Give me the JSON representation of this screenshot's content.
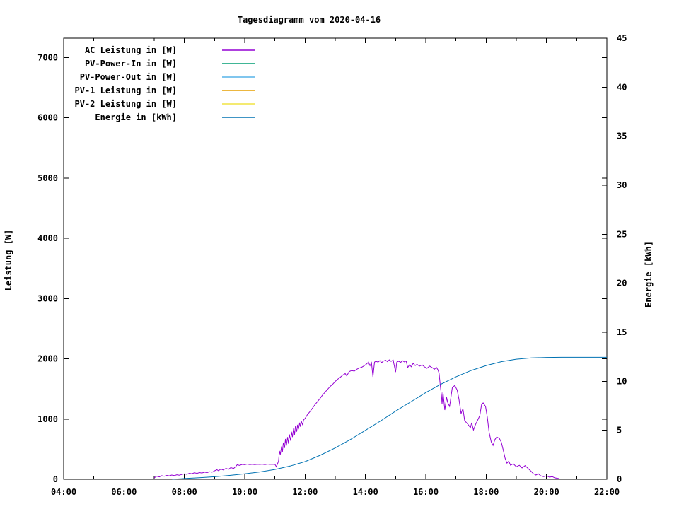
{
  "title": "Tagesdiagramm vom 2020-04-16",
  "chart_data": {
    "type": "line",
    "title": "Tagesdiagramm vom 2020-04-16",
    "grid": false,
    "legend_position": "top-left-inside",
    "x_axis": {
      "min": 4,
      "max": 22,
      "major": [
        {
          "t": 4,
          "label": "04:00"
        },
        {
          "t": 6,
          "label": "06:00"
        },
        {
          "t": 8,
          "label": "08:00"
        },
        {
          "t": 10,
          "label": "10:00"
        },
        {
          "t": 12,
          "label": "12:00"
        },
        {
          "t": 14,
          "label": "14:00"
        },
        {
          "t": 16,
          "label": "16:00"
        },
        {
          "t": 18,
          "label": "18:00"
        },
        {
          "t": 20,
          "label": "20:00"
        },
        {
          "t": 22,
          "label": "22:00"
        }
      ],
      "minor": [
        5,
        7,
        9,
        11,
        13,
        15,
        17,
        19,
        21
      ]
    },
    "y_left": {
      "label": "Leistung [W]",
      "ticks": [
        0,
        1000,
        2000,
        3000,
        4000,
        5000,
        6000,
        7000
      ],
      "max": 7320
    },
    "y_right": {
      "label": "Energie [kWh]",
      "ticks": [
        0,
        5,
        10,
        15,
        20,
        25,
        30,
        35,
        40,
        45
      ],
      "max": 45
    },
    "series": [
      {
        "name": "AC Leistung in [W]",
        "color": "#9400d3",
        "axis": "left",
        "points": [
          [
            7.0,
            25
          ],
          [
            7.08,
            50
          ],
          [
            7.17,
            40
          ],
          [
            7.25,
            60
          ],
          [
            7.33,
            50
          ],
          [
            7.42,
            65
          ],
          [
            7.5,
            58
          ],
          [
            7.58,
            70
          ],
          [
            7.67,
            62
          ],
          [
            7.75,
            75
          ],
          [
            7.83,
            68
          ],
          [
            7.92,
            80
          ],
          [
            8.0,
            90
          ],
          [
            8.08,
            82
          ],
          [
            8.17,
            100
          ],
          [
            8.25,
            92
          ],
          [
            8.33,
            108
          ],
          [
            8.42,
            98
          ],
          [
            8.5,
            112
          ],
          [
            8.58,
            104
          ],
          [
            8.67,
            118
          ],
          [
            8.75,
            110
          ],
          [
            8.83,
            125
          ],
          [
            8.92,
            118
          ],
          [
            9.0,
            140
          ],
          [
            9.08,
            158
          ],
          [
            9.13,
            142
          ],
          [
            9.21,
            170
          ],
          [
            9.29,
            155
          ],
          [
            9.38,
            182
          ],
          [
            9.46,
            165
          ],
          [
            9.54,
            195
          ],
          [
            9.63,
            178
          ],
          [
            9.71,
            215
          ],
          [
            9.75,
            240
          ],
          [
            9.83,
            230
          ],
          [
            9.92,
            248
          ],
          [
            10.0,
            242
          ],
          [
            10.08,
            252
          ],
          [
            10.17,
            244
          ],
          [
            10.25,
            250
          ],
          [
            10.33,
            243
          ],
          [
            10.42,
            250
          ],
          [
            10.5,
            246
          ],
          [
            10.58,
            251
          ],
          [
            10.67,
            244
          ],
          [
            10.75,
            252
          ],
          [
            10.83,
            247
          ],
          [
            10.92,
            250
          ],
          [
            11.0,
            248
          ],
          [
            11.05,
            208
          ],
          [
            11.08,
            250
          ],
          [
            11.12,
            300
          ],
          [
            11.15,
            470
          ],
          [
            11.18,
            410
          ],
          [
            11.22,
            545
          ],
          [
            11.25,
            455
          ],
          [
            11.28,
            610
          ],
          [
            11.32,
            520
          ],
          [
            11.35,
            670
          ],
          [
            11.38,
            560
          ],
          [
            11.42,
            700
          ],
          [
            11.45,
            590
          ],
          [
            11.48,
            745
          ],
          [
            11.52,
            640
          ],
          [
            11.55,
            790
          ],
          [
            11.58,
            700
          ],
          [
            11.62,
            845
          ],
          [
            11.65,
            740
          ],
          [
            11.68,
            880
          ],
          [
            11.72,
            790
          ],
          [
            11.75,
            905
          ],
          [
            11.78,
            830
          ],
          [
            11.82,
            940
          ],
          [
            11.85,
            870
          ],
          [
            11.88,
            960
          ],
          [
            11.92,
            900
          ],
          [
            11.95,
            985
          ],
          [
            12.0,
            1010
          ],
          [
            12.08,
            1075
          ],
          [
            12.17,
            1130
          ],
          [
            12.25,
            1185
          ],
          [
            12.33,
            1240
          ],
          [
            12.42,
            1295
          ],
          [
            12.5,
            1345
          ],
          [
            12.58,
            1400
          ],
          [
            12.67,
            1450
          ],
          [
            12.75,
            1495
          ],
          [
            12.83,
            1540
          ],
          [
            12.92,
            1580
          ],
          [
            13.0,
            1625
          ],
          [
            13.08,
            1660
          ],
          [
            13.17,
            1695
          ],
          [
            13.25,
            1730
          ],
          [
            13.33,
            1755
          ],
          [
            13.38,
            1715
          ],
          [
            13.46,
            1785
          ],
          [
            13.54,
            1805
          ],
          [
            13.63,
            1795
          ],
          [
            13.71,
            1825
          ],
          [
            13.79,
            1845
          ],
          [
            13.88,
            1860
          ],
          [
            13.96,
            1885
          ],
          [
            14.04,
            1915
          ],
          [
            14.1,
            1945
          ],
          [
            14.15,
            1885
          ],
          [
            14.2,
            1935
          ],
          [
            14.25,
            1700
          ],
          [
            14.3,
            1945
          ],
          [
            14.35,
            1958
          ],
          [
            14.42,
            1945
          ],
          [
            14.48,
            1968
          ],
          [
            14.54,
            1938
          ],
          [
            14.6,
            1962
          ],
          [
            14.67,
            1975
          ],
          [
            14.73,
            1952
          ],
          [
            14.79,
            1982
          ],
          [
            14.85,
            1958
          ],
          [
            14.92,
            1978
          ],
          [
            15.0,
            1780
          ],
          [
            15.04,
            1945
          ],
          [
            15.1,
            1958
          ],
          [
            15.17,
            1942
          ],
          [
            15.23,
            1968
          ],
          [
            15.29,
            1948
          ],
          [
            15.35,
            1962
          ],
          [
            15.4,
            1855
          ],
          [
            15.46,
            1898
          ],
          [
            15.52,
            1868
          ],
          [
            15.58,
            1925
          ],
          [
            15.65,
            1888
          ],
          [
            15.71,
            1908
          ],
          [
            15.79,
            1878
          ],
          [
            15.88,
            1898
          ],
          [
            15.96,
            1865
          ],
          [
            16.04,
            1842
          ],
          [
            16.13,
            1878
          ],
          [
            16.21,
            1852
          ],
          [
            16.29,
            1828
          ],
          [
            16.35,
            1858
          ],
          [
            16.4,
            1818
          ],
          [
            16.44,
            1760
          ],
          [
            16.48,
            1560
          ],
          [
            16.52,
            1390
          ],
          [
            16.54,
            1250
          ],
          [
            16.57,
            1450
          ],
          [
            16.63,
            1150
          ],
          [
            16.69,
            1360
          ],
          [
            16.73,
            1270
          ],
          [
            16.79,
            1210
          ],
          [
            16.88,
            1520
          ],
          [
            16.96,
            1558
          ],
          [
            17.04,
            1480
          ],
          [
            17.1,
            1330
          ],
          [
            17.17,
            1090
          ],
          [
            17.23,
            1172
          ],
          [
            17.29,
            972
          ],
          [
            17.35,
            940
          ],
          [
            17.4,
            912
          ],
          [
            17.48,
            855
          ],
          [
            17.52,
            938
          ],
          [
            17.58,
            818
          ],
          [
            17.65,
            912
          ],
          [
            17.71,
            972
          ],
          [
            17.79,
            1058
          ],
          [
            17.85,
            1242
          ],
          [
            17.9,
            1268
          ],
          [
            17.98,
            1208
          ],
          [
            18.04,
            1030
          ],
          [
            18.1,
            775
          ],
          [
            18.17,
            618
          ],
          [
            18.23,
            562
          ],
          [
            18.29,
            658
          ],
          [
            18.35,
            702
          ],
          [
            18.44,
            678
          ],
          [
            18.5,
            618
          ],
          [
            18.56,
            502
          ],
          [
            18.63,
            348
          ],
          [
            18.69,
            268
          ],
          [
            18.75,
            302
          ],
          [
            18.81,
            232
          ],
          [
            18.9,
            258
          ],
          [
            19.0,
            208
          ],
          [
            19.1,
            232
          ],
          [
            19.19,
            188
          ],
          [
            19.29,
            228
          ],
          [
            19.38,
            185
          ],
          [
            19.48,
            138
          ],
          [
            19.56,
            95
          ],
          [
            19.65,
            70
          ],
          [
            19.73,
            92
          ],
          [
            19.81,
            58
          ],
          [
            19.9,
            45
          ],
          [
            20.0,
            58
          ],
          [
            20.1,
            35
          ],
          [
            20.19,
            45
          ],
          [
            20.27,
            25
          ],
          [
            20.35,
            18
          ],
          [
            20.43,
            10
          ]
        ]
      },
      {
        "name": "PV-Power-In in [W]",
        "color": "#009e73",
        "axis": "left",
        "points": []
      },
      {
        "name": "PV-Power-Out in [W]",
        "color": "#56b4e9",
        "axis": "left",
        "points": []
      },
      {
        "name": "PV-1 Leistung in [W]",
        "color": "#e69f00",
        "axis": "left",
        "points": []
      },
      {
        "name": "PV-2 Leistung in [W]",
        "color": "#f0e442",
        "axis": "left",
        "points": []
      },
      {
        "name": "Energie in [kWh]",
        "color": "#0072b2",
        "axis": "right",
        "points": [
          [
            7.6,
            0.0
          ],
          [
            8.0,
            0.08
          ],
          [
            8.5,
            0.16
          ],
          [
            9.0,
            0.26
          ],
          [
            9.5,
            0.4
          ],
          [
            10.0,
            0.56
          ],
          [
            10.5,
            0.75
          ],
          [
            11.0,
            1.0
          ],
          [
            11.5,
            1.35
          ],
          [
            12.0,
            1.8
          ],
          [
            12.5,
            2.45
          ],
          [
            13.0,
            3.2
          ],
          [
            13.5,
            4.05
          ],
          [
            14.0,
            5.0
          ],
          [
            14.5,
            5.95
          ],
          [
            15.0,
            6.95
          ],
          [
            15.5,
            7.9
          ],
          [
            16.0,
            8.85
          ],
          [
            16.5,
            9.7
          ],
          [
            17.0,
            10.45
          ],
          [
            17.5,
            11.1
          ],
          [
            18.0,
            11.6
          ],
          [
            18.5,
            12.0
          ],
          [
            19.0,
            12.25
          ],
          [
            19.5,
            12.38
          ],
          [
            20.0,
            12.43
          ],
          [
            20.5,
            12.45
          ],
          [
            21.0,
            12.45
          ],
          [
            21.5,
            12.45
          ],
          [
            22.0,
            12.45
          ]
        ]
      }
    ]
  }
}
